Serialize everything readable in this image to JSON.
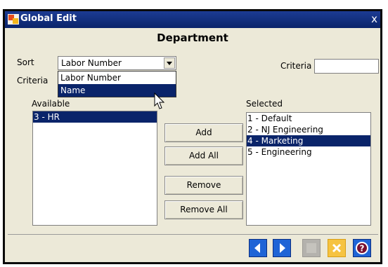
{
  "window": {
    "title": "Global Edit",
    "heading": "Department",
    "close_glyph": "x"
  },
  "sort": {
    "label": "Sort",
    "selected": "Labor Number",
    "options": [
      "Labor Number",
      "Name"
    ],
    "highlighted_option": "Name"
  },
  "criteria": {
    "left_label": "Criteria",
    "right_label": "Criteria",
    "value": ""
  },
  "available": {
    "label": "Available",
    "items": [
      "3 - HR"
    ],
    "selected_index": 0
  },
  "selected_list": {
    "label": "Selected",
    "items": [
      "1 - Default",
      "2 - NJ Engineering",
      "4 - Marketing",
      "5 - Engineering"
    ],
    "selected_index": 2
  },
  "buttons": {
    "add": "Add",
    "add_all": "Add All",
    "remove": "Remove",
    "remove_all": "Remove All"
  },
  "footer": {
    "icons": [
      "prev-arrow-icon",
      "next-arrow-icon",
      "disabled-icon",
      "cancel-icon",
      "help-icon"
    ]
  },
  "colors": {
    "titlebar": "#0a246a",
    "selection": "#0a246a",
    "window_bg": "#ece9d8",
    "nav_button": "#1f64d6",
    "cancel_button": "#f6c340"
  }
}
